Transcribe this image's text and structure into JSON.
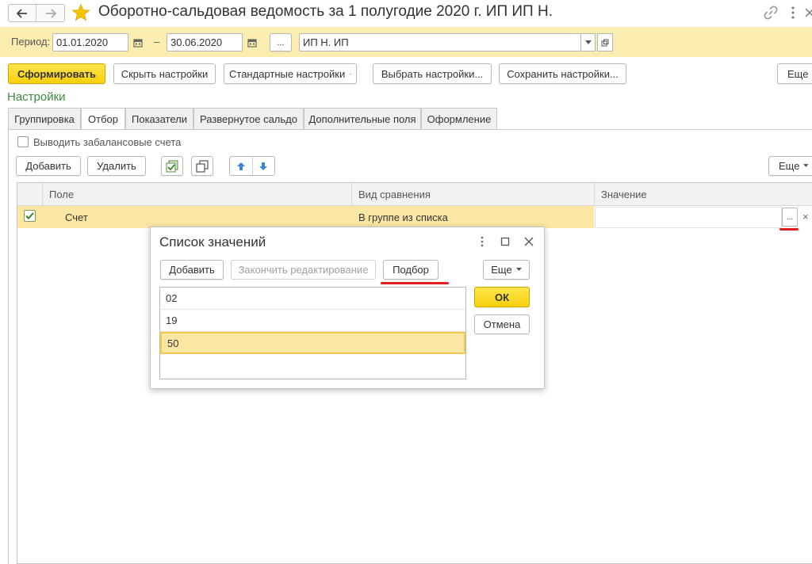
{
  "window": {
    "title": "Оборотно-сальдовая ведомость за 1 полугодие 2020 г. ИП ИП Н.",
    "back_icon": "arrow-left-icon",
    "forward_icon": "arrow-right-icon",
    "favorite_icon": "star-icon",
    "link_icon": "link-icon",
    "menu_icon": "kebab-menu-icon",
    "close_icon": "close-icon"
  },
  "period": {
    "label": "Период:",
    "from": "01.01.2020",
    "dash": "–",
    "to": "30.06.2020",
    "select_label": "...",
    "organization": "ИП Н. ИП"
  },
  "toolbar": {
    "generate_label": "Сформировать",
    "hide_settings_label": "Скрыть настройки",
    "standard_settings_label": "Стандартные настройки",
    "choose_settings_label": "Выбрать настройки...",
    "save_settings_label": "Сохранить настройки...",
    "more_label": "Еще"
  },
  "settings": {
    "heading": "Настройки",
    "tabs": [
      {
        "label": "Группировка"
      },
      {
        "label": "Отбор"
      },
      {
        "label": "Показатели"
      },
      {
        "label": "Развернутое сальдо"
      },
      {
        "label": "Дополнительные поля"
      },
      {
        "label": "Оформление"
      }
    ],
    "active_tab": "Отбор",
    "offbalance_label": "Выводить забалансовые счета",
    "add_label": "Добавить",
    "delete_label": "Удалить",
    "more_label": "Еще",
    "columns": [
      "Поле",
      "Вид сравнения",
      "Значение"
    ],
    "rows": [
      {
        "checked": true,
        "field": "Счет",
        "comparison": "В группе из списка",
        "value": "",
        "select_label": "...",
        "clear_label": "×"
      }
    ]
  },
  "dialog": {
    "title": "Список значений",
    "add_label": "Добавить",
    "finish_edit_label": "Закончить редактирование",
    "pick_label": "Подбор",
    "more_label": "Еще",
    "ok_label": "ОК",
    "cancel_label": "Отмена",
    "values": [
      "02",
      "19",
      "50",
      ""
    ],
    "selected_value": "50"
  },
  "colors": {
    "accent_yellow": "#f7d00c",
    "header_band": "#fbecb0",
    "selected_row": "#fbe7a3",
    "settings_green": "#3f8a3f",
    "highlight_red": "#e01e1e",
    "arrow_blue": "#3b84d6"
  }
}
